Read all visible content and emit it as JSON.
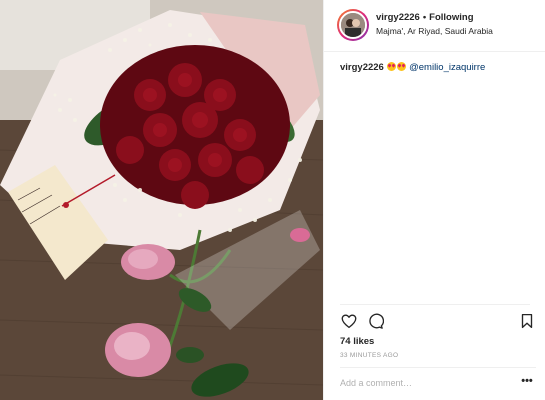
{
  "post": {
    "username": "virgy2226",
    "separator": "•",
    "follow_label": "Following",
    "location": "Majma', Ar Riyad, Saudi Arabia"
  },
  "caption": {
    "username": "virgy2226",
    "emojis": [
      "smiling-face-with-heart-eyes",
      "smiling-face-with-heart-eyes"
    ],
    "mention": "@emilio_izaquirre"
  },
  "photo": {
    "card_note": "Ilove my Teddy bear. TE AMO MI CHANCHITO ..."
  },
  "engagement": {
    "likes": "74 likes",
    "time": "33 MINUTES AGO"
  },
  "comment": {
    "placeholder": "Add a comment…",
    "more_label": "•••"
  },
  "icons": {
    "like": "heart-outline-icon",
    "comment": "speech-bubble-icon",
    "save": "bookmark-icon",
    "more": "more-options-icon"
  },
  "colors": {
    "mention": "#003569",
    "text": "#262626",
    "muted": "#999999",
    "separator": "#efefef"
  }
}
